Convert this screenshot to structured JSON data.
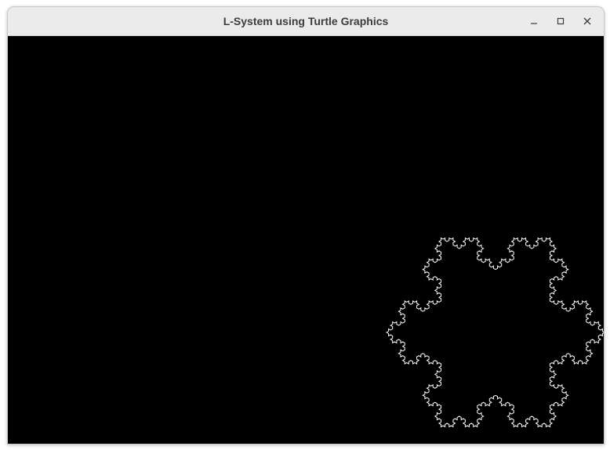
{
  "window": {
    "title": "L-System using Turtle Graphics"
  },
  "controls": {
    "minimize_icon": "minimize-icon",
    "maximize_icon": "maximize-icon",
    "close_icon": "close-icon"
  },
  "canvas": {
    "background": "#000000",
    "stroke_color": "#ffffff",
    "fractal": "koch-snowflake"
  }
}
